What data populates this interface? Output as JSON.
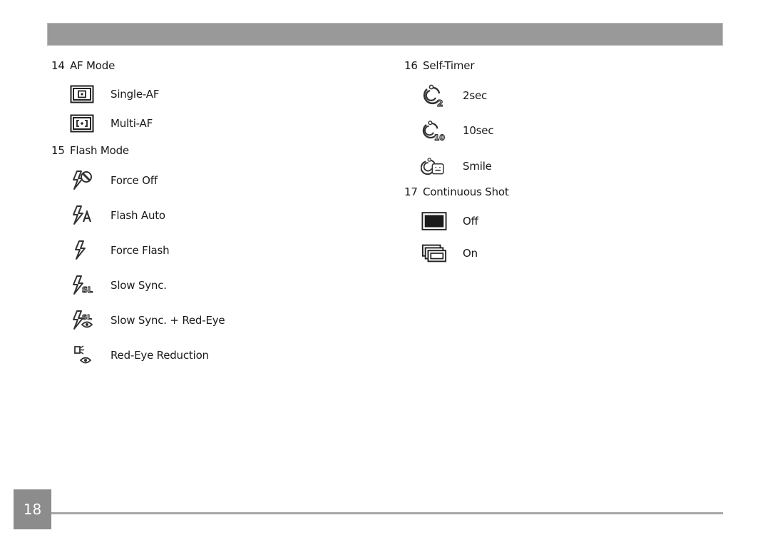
{
  "header": {
    "bar_color": "#999999"
  },
  "left_column": {
    "sections": [
      {
        "number": "14",
        "title": "AF Mode",
        "items": [
          {
            "icon": "single-af-icon",
            "label": "Single-AF"
          },
          {
            "icon": "multi-af-icon",
            "label": "Multi-AF"
          }
        ]
      },
      {
        "number": "15",
        "title": "Flash Mode",
        "items": [
          {
            "icon": "flash-force-off-icon",
            "label": "Force Off"
          },
          {
            "icon": "flash-auto-icon",
            "label": "Flash Auto"
          },
          {
            "icon": "force-flash-icon",
            "label": "Force Flash"
          },
          {
            "icon": "slow-sync-icon",
            "label": "Slow Sync."
          },
          {
            "icon": "slow-sync-red-eye-icon",
            "label": "Slow Sync. + Red-Eye"
          },
          {
            "icon": "red-eye-reduction-icon",
            "label": "Red-Eye Reduction"
          }
        ]
      }
    ]
  },
  "right_column": {
    "sections": [
      {
        "number": "16",
        "title": "Self-Timer",
        "items": [
          {
            "icon": "self-timer-2sec-icon",
            "label": "2sec",
            "badge": "2"
          },
          {
            "icon": "self-timer-10sec-icon",
            "label": "10sec",
            "badge": "10"
          },
          {
            "icon": "self-timer-smile-icon",
            "label": "Smile"
          }
        ]
      },
      {
        "number": "17",
        "title": "Continuous Shot",
        "items": [
          {
            "icon": "continuous-shot-off-icon",
            "label": "Off"
          },
          {
            "icon": "continuous-shot-on-icon",
            "label": "On"
          }
        ]
      }
    ]
  },
  "footer": {
    "page_number": "18",
    "accent_color": "#8c8c8c"
  }
}
